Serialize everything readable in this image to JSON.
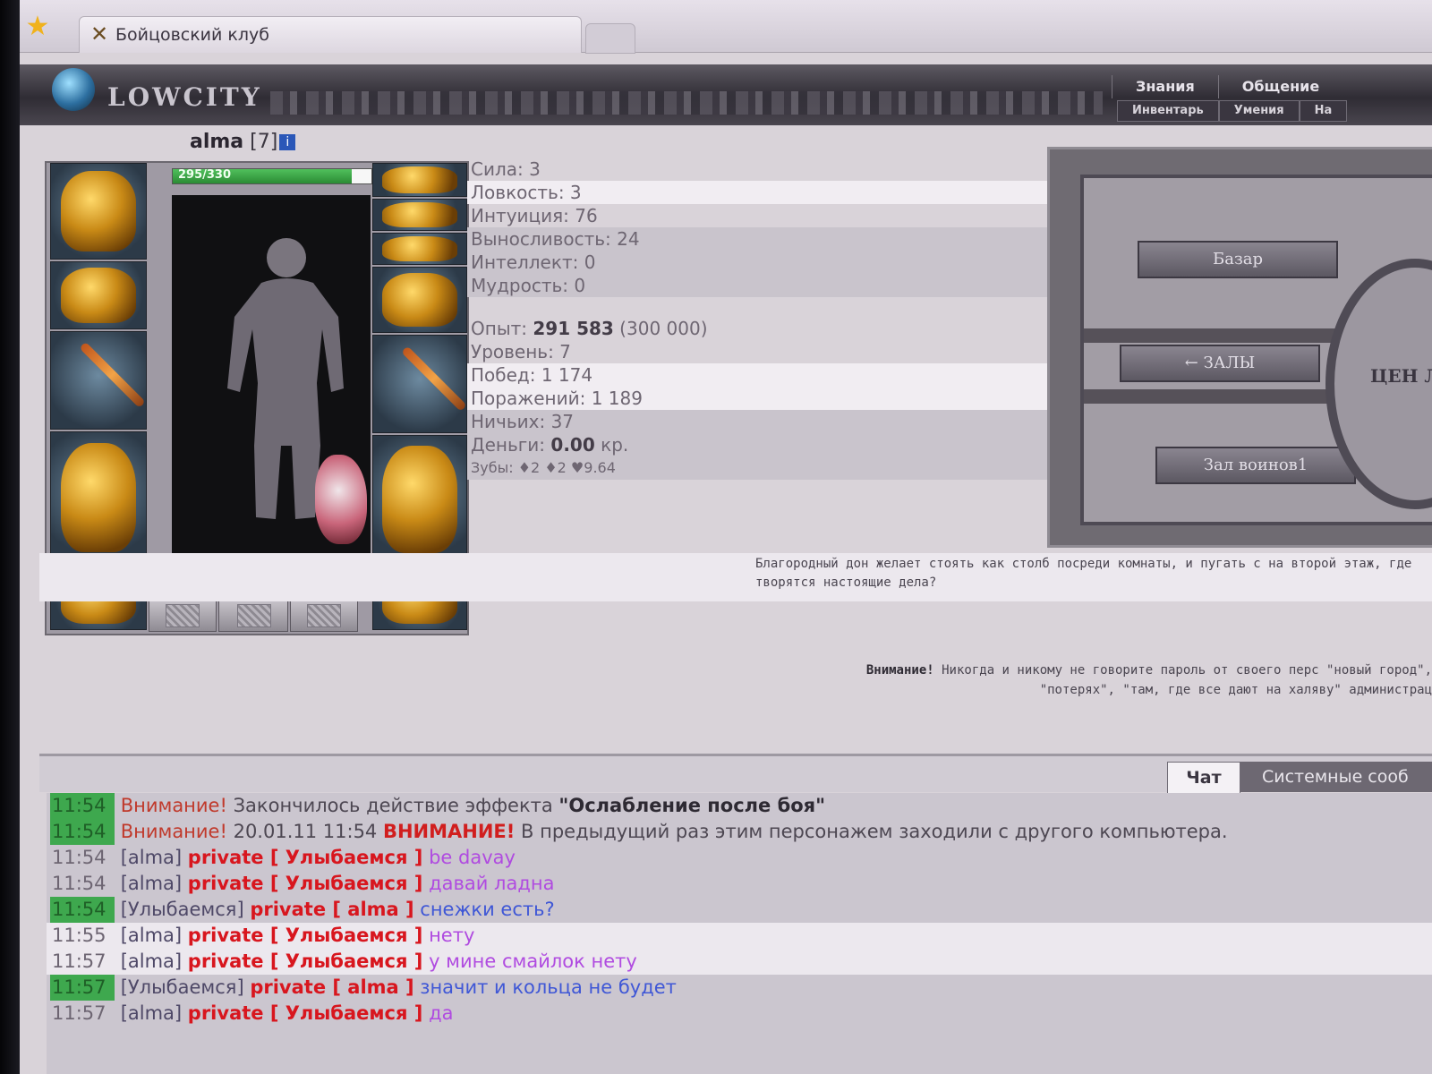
{
  "browser": {
    "tab_title": "Бойцовский клуб"
  },
  "header": {
    "logo": "LOWCITY",
    "nav_top": [
      "Знания",
      "Общение"
    ],
    "nav_sub": [
      "Инвентарь",
      "Умения",
      "На"
    ]
  },
  "player": {
    "name": "alma",
    "level": "[7]",
    "hp": "295/330",
    "hp_fraction": 0.9
  },
  "stats": {
    "strength": "Сила: 3",
    "agility": "Ловкость: 3",
    "intuition": "Интуиция: 76",
    "endurance": "Выносливость: 24",
    "intellect": "Интеллект: 0",
    "wisdom": "Мудрость: 0",
    "exp_label": "Опыт: ",
    "exp_value": "291 583",
    "exp_next": " (300 000)",
    "level": "Уровень: 7",
    "wins": "Побед: 1 174",
    "losses": "Поражений: 1 189",
    "draws": "Ничьих: 37",
    "money_label": "Деньги: ",
    "money_value": "0.00",
    "money_unit": " кр.",
    "teeth": "Зубы: ♦2 ♦2 ♥9.64"
  },
  "map": {
    "btn_bazaar": "Базар",
    "btn_halls": "← ЗАЛЫ",
    "btn_hall": "Зал воинов1",
    "circle": "ЦЕН ЛЬ"
  },
  "notices": {
    "quote": "Благородный дон желает стоять как столб посреди комнаты, и пугать с на второй этаж, где творятся настоящие дела?",
    "warning_bold": "Внимание!",
    "warning_text": " Никогда и никому не говорите пароль от своего перс \"новый город\", \"потерях\", \"там, где все дают на халяву\" администрац"
  },
  "chat_tabs": [
    "Чат",
    "Системные сооб"
  ],
  "chat": {
    "l1": {
      "time": "11:54",
      "warn": "Внимание!",
      "text": " Закончилось действие эффекта ",
      "bold": "\"Ослабление после боя\""
    },
    "l2": {
      "time": "11:54",
      "warn": "Внимание!",
      "date": " 20.01.11 11:54 ",
      "caps": "ВНИМАНИЕ!",
      "text": " В предыдущий раз этим персонажем заходили с другого компьютера."
    },
    "l3": {
      "time": "11:54",
      "nick": "[alma]",
      "priv": "private [ Улыбаемся ]",
      "msg": " be davay"
    },
    "l4": {
      "time": "11:54",
      "nick": "[alma]",
      "priv": "private [ Улыбаемся ]",
      "msg": " давай ладна"
    },
    "l5": {
      "time": "11:54",
      "nick": "[Улыбаемся]",
      "priv": "private [ alma ]",
      "msg": " снежки есть?"
    },
    "l6": {
      "time": "11:55",
      "nick": "[alma]",
      "priv": "private [ Улыбаемся ]",
      "msg": " нету"
    },
    "l7": {
      "time": "11:57",
      "nick": "[alma]",
      "priv": "private [ Улыбаемся ]",
      "msg": " у мине смайлок нету"
    },
    "l8": {
      "time": "11:57",
      "nick": "[Улыбаемся]",
      "priv": "private [ alma ]",
      "msg": " значит и кольца не будет"
    },
    "l9": {
      "time": "11:57",
      "nick": "[alma]",
      "priv": "private [ Улыбаемся ]",
      "msg": " да"
    }
  }
}
